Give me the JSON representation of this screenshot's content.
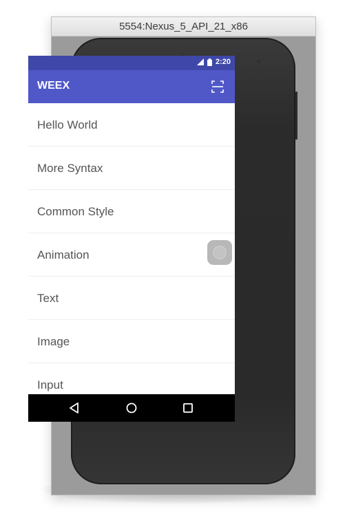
{
  "emulator": {
    "window_title": "5554:Nexus_5_API_21_x86"
  },
  "status_bar": {
    "time": "2:20",
    "icons": [
      "signal-icon",
      "battery-icon"
    ]
  },
  "app_bar": {
    "title": "WEEX",
    "action_icon": "scan-icon"
  },
  "list": {
    "items": [
      {
        "label": "Hello World"
      },
      {
        "label": "More Syntax"
      },
      {
        "label": "Common Style"
      },
      {
        "label": "Animation"
      },
      {
        "label": "Text"
      },
      {
        "label": "Image"
      },
      {
        "label": "Input"
      }
    ]
  },
  "nav_bar": {
    "buttons": [
      "back-icon",
      "home-icon",
      "recents-icon"
    ]
  },
  "colors": {
    "status_bar": "#3f48a8",
    "app_bar": "#5058c8",
    "list_background": "#ffffff",
    "list_text": "#555555",
    "nav_bar": "#000000"
  }
}
